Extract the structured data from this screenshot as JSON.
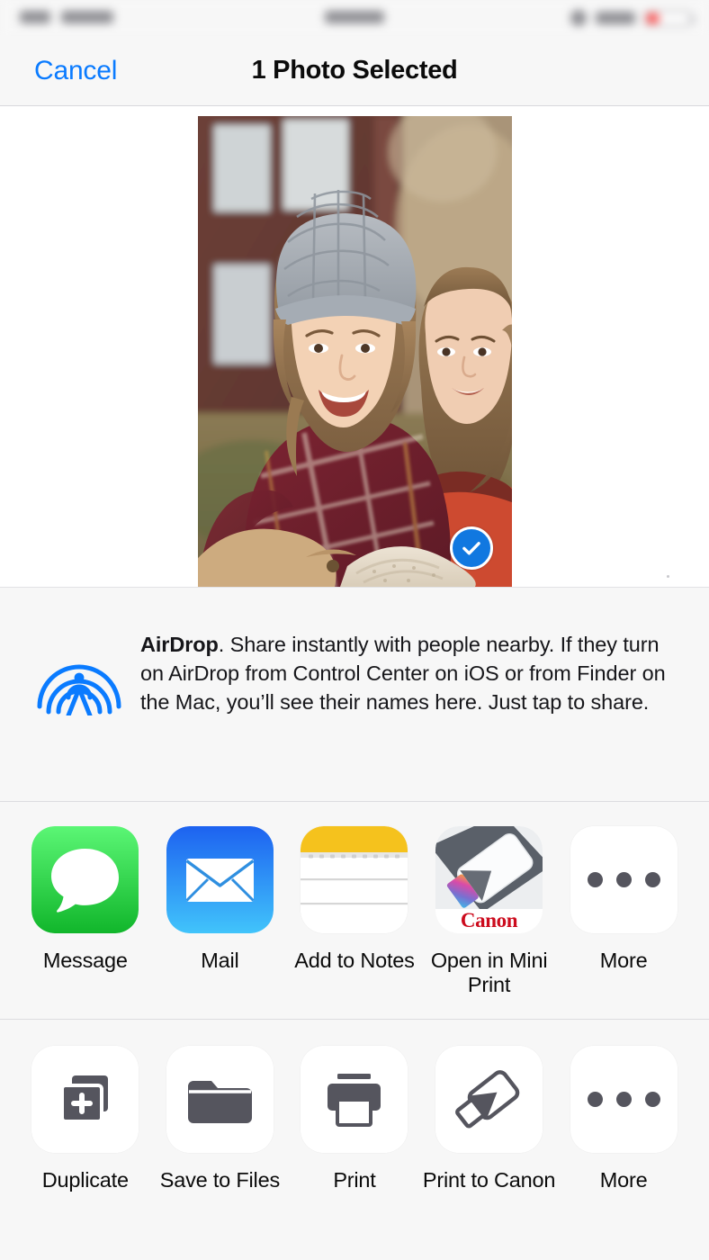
{
  "status_bar": {
    "blurred": true,
    "carrier": "",
    "time": "",
    "battery_color": "#ff4d4d"
  },
  "nav": {
    "cancel_label": "Cancel",
    "title": "1 Photo Selected",
    "cancel_color": "#0a7bff"
  },
  "preview": {
    "selected_count": 1,
    "checkmark_color": "#1178e0",
    "alt": "Two girls smiling outdoors, one wearing a gray knit beanie and plaid flannel shirt"
  },
  "airdrop": {
    "icon": "airdrop-icon",
    "title": "AirDrop",
    "body": ". Share instantly with people nearby. If they turn on AirDrop from Control Center on iOS or from Finder on the Mac, you’ll see their names here. Just tap to share.",
    "icon_color": "#0a7bff"
  },
  "apps_row": [
    {
      "id": "message",
      "icon": "messages-icon",
      "label": "Message"
    },
    {
      "id": "mail",
      "icon": "mail-icon",
      "label": "Mail"
    },
    {
      "id": "notes",
      "icon": "notes-icon",
      "label": "Add to Notes"
    },
    {
      "id": "miniprint",
      "icon": "canon-mini-print-icon",
      "label": "Open in Mini Print"
    },
    {
      "id": "more-apps",
      "icon": "more-dots-icon",
      "label": "More"
    }
  ],
  "actions_row": [
    {
      "id": "duplicate",
      "icon": "duplicate-icon",
      "label": "Duplicate"
    },
    {
      "id": "save-to-files",
      "icon": "folder-icon",
      "label": "Save to Files"
    },
    {
      "id": "print",
      "icon": "printer-icon",
      "label": "Print"
    },
    {
      "id": "print-canon",
      "icon": "canon-printer-icon",
      "label": "Print to Canon"
    },
    {
      "id": "more-actions",
      "icon": "more-dots-icon",
      "label": "More"
    }
  ],
  "theme": {
    "background": "#f7f7f7",
    "card_background": "#ffffff",
    "separator": "#dcdce0",
    "text_primary": "#0b0b0b",
    "icon_gray": "#55555e",
    "canon_red": "#cc0b1d"
  }
}
